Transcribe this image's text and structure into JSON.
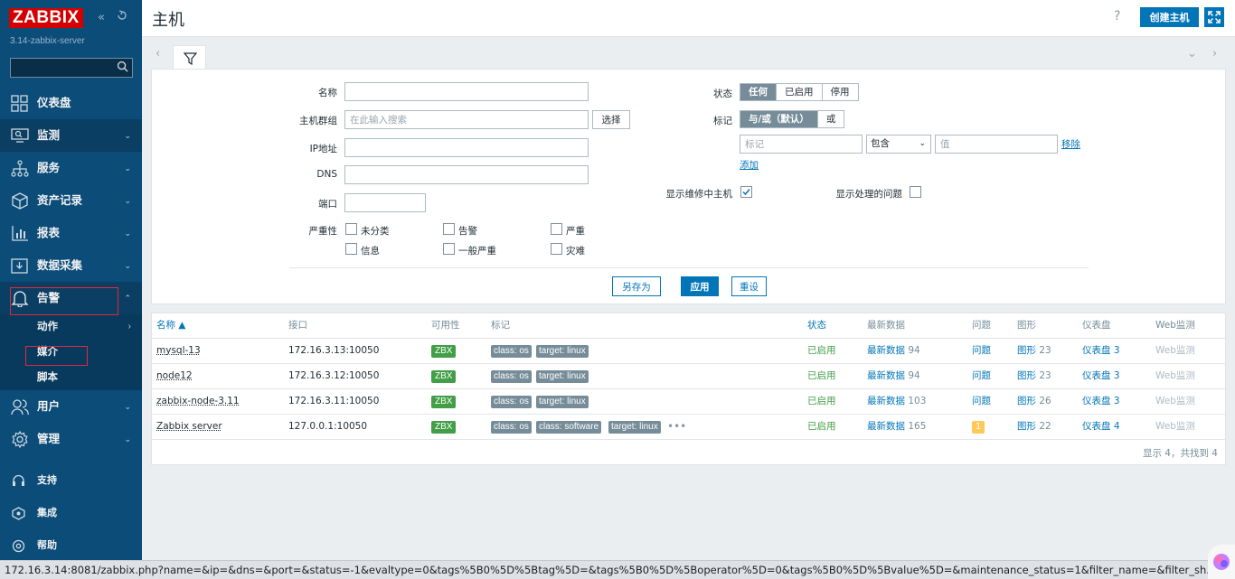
{
  "sidebar": {
    "logo": "ZABBIX",
    "server_name": "3.14-zabbix-server",
    "menu": [
      {
        "label": "仪表盘"
      },
      {
        "label": "监测"
      },
      {
        "label": "服务"
      },
      {
        "label": "资产记录"
      },
      {
        "label": "报表"
      },
      {
        "label": "数据采集"
      },
      {
        "label": "告警"
      },
      {
        "label": "用户"
      },
      {
        "label": "管理"
      }
    ],
    "alert_submenu": [
      {
        "label": "动作"
      },
      {
        "label": "媒介"
      },
      {
        "label": "脚本"
      }
    ],
    "bottom": [
      {
        "label": "支持"
      },
      {
        "label": "集成"
      },
      {
        "label": "帮助"
      }
    ]
  },
  "header": {
    "title": "主机",
    "help": "?",
    "create_button": "创建主机"
  },
  "filter": {
    "labels": {
      "name": "名称",
      "host_group": "主机群组",
      "ip": "IP地址",
      "dns": "DNS",
      "port": "端口",
      "severity": "严重性",
      "status": "状态",
      "tags": "标记",
      "maintenance": "显示维修中主机",
      "suppressed": "显示处理的问题"
    },
    "host_group_placeholder": "在此输入搜索",
    "select_button": "选择",
    "severities": [
      "未分类",
      "告警",
      "严重",
      "信息",
      "一般严重",
      "灾难"
    ],
    "status_options": [
      "任何",
      "已启用",
      "停用"
    ],
    "tag_eval_options": [
      "与/或（默认）",
      "或"
    ],
    "tag_placeholder": "标记",
    "tag_operator": "包含",
    "value_placeholder": "值",
    "remove_link": "移除",
    "add_link": "添加",
    "buttons": {
      "save_as": "另存为",
      "apply": "应用",
      "reset": "重设"
    }
  },
  "table": {
    "headers": [
      "名称 ▲",
      "接口",
      "可用性",
      "标记",
      "状态",
      "最新数据",
      "问题",
      "图形",
      "仪表盘",
      "Web监测"
    ],
    "rows": [
      {
        "name": "mysql-13",
        "interface": "172.16.3.13:10050",
        "availability": "ZBX",
        "tags": [
          "class: os",
          "target: linux"
        ],
        "status": "已启用",
        "latest_label": "最新数据",
        "latest_count": "94",
        "problems": "问题",
        "graphs_label": "图形",
        "graphs_count": "23",
        "dash_label": "仪表盘",
        "dash_count": "3",
        "web": "Web监测"
      },
      {
        "name": "node12",
        "interface": "172.16.3.12:10050",
        "availability": "ZBX",
        "tags": [
          "class: os",
          "target: linux"
        ],
        "status": "已启用",
        "latest_label": "最新数据",
        "latest_count": "94",
        "problems": "问题",
        "graphs_label": "图形",
        "graphs_count": "23",
        "dash_label": "仪表盘",
        "dash_count": "3",
        "web": "Web监测"
      },
      {
        "name": "zabbix-node-3.11",
        "interface": "172.16.3.11:10050",
        "availability": "ZBX",
        "tags": [
          "class: os",
          "target: linux"
        ],
        "status": "已启用",
        "latest_label": "最新数据",
        "latest_count": "103",
        "problems": "问题",
        "graphs_label": "图形",
        "graphs_count": "26",
        "dash_label": "仪表盘",
        "dash_count": "3",
        "web": "Web监测"
      },
      {
        "name": "Zabbix server",
        "interface": "127.0.0.1:10050",
        "availability": "ZBX",
        "tags": [
          "class: os",
          "class: software",
          "target: linux"
        ],
        "status": "已启用",
        "latest_label": "最新数据",
        "latest_count": "165",
        "problems": "1",
        "graphs_label": "图形",
        "graphs_count": "22",
        "dash_label": "仪表盘",
        "dash_count": "4",
        "web": "Web监测"
      }
    ],
    "footer": "显示 4，共找到 4"
  },
  "statusbar": {
    "url": "172.16.3.14:8081/zabbix.php?name=&ip=&dns=&port=&status=-1&evaltype=0&tags%5B0%5D%5Btag%5D=&tags%5B0%5D%5Boperator%5D=0&tags%5B0%5D%5Bvalue%5D=&maintenance_status=1&filter_name=&filter_sh..."
  },
  "colors": {
    "sidebar": "#0b4c79",
    "accent": "#0275b8",
    "logo_red": "#d40000",
    "ok_green": "#429e47",
    "tag_grey": "#768d99",
    "problem_yellow": "#ffc859",
    "highlight_red": "#e3283d"
  }
}
